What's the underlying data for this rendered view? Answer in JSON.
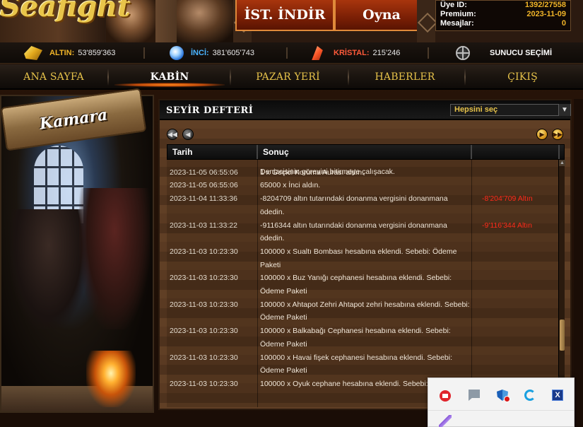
{
  "header": {
    "download_button": "İST. İNDİR",
    "play_button": "Oyna",
    "user": {
      "id_label": "Üye ID:",
      "id_value": "1392/27558",
      "premium_label": "Premium:",
      "premium_value": "2023-11-09",
      "messages_label": "Mesajlar:",
      "messages_value": "0"
    }
  },
  "resources": {
    "gold": {
      "label": "ALTIN:",
      "value": "53'859'363",
      "icon": "gold-icon",
      "color": "#f0b428"
    },
    "pearl": {
      "label": "İNCİ:",
      "value": "381'605'743",
      "icon": "pearl-icon",
      "color": "#4ab4ff"
    },
    "crystal": {
      "label": "KRİSTAL:",
      "value": "215'246",
      "icon": "crystal-icon",
      "color": "#ff5a3a"
    },
    "server": {
      "label": "SUNUCU SEÇİMİ",
      "icon": "globe-icon"
    }
  },
  "nav": {
    "items": [
      {
        "label": "ANA SAYFA"
      },
      {
        "label": "KABİN"
      },
      {
        "label": "PAZAR YERİ"
      },
      {
        "label": "HABERLER"
      },
      {
        "label": "ÇIKIŞ"
      }
    ],
    "active_index": 1
  },
  "left_panel": {
    "banner": "Kamara"
  },
  "logbook": {
    "title": "SEYİR DEFTERİ",
    "filter_value": "Hepsini seç",
    "columns": [
      "Tarih",
      "Sonuç",
      ""
    ],
    "rows": [
      {
        "date": "",
        "result": "Denizcisinin görevini bitirmeye çalışacak.",
        "amount": ""
      },
      {
        "date": "2023-11-05 06:55:06",
        "result": "1 x Geçici Koruma Aurası aldın.",
        "amount": ""
      },
      {
        "date": "2023-11-05 06:55:06",
        "result": "65000 x İnci aldın.",
        "amount": ""
      },
      {
        "date": "2023-11-04 11:33:36",
        "result": "-8204709 altın tutarındaki donanma vergisini donanmana ödedin.",
        "amount": "-8'204'709 Altın"
      },
      {
        "date": "2023-11-03 11:33:22",
        "result": "-9116344 altın tutarındaki donanma vergisini donanmana ödedin.",
        "amount": "-9'116'344 Altın"
      },
      {
        "date": "2023-11-03 10:23:30",
        "result": "100000 x Sualtı Bombası hesabına eklendi. Sebebi: Ödeme Paketi",
        "amount": ""
      },
      {
        "date": "2023-11-03 10:23:30",
        "result": "100000 x Buz Yanığı cephanesi hesabına eklendi. Sebebi: Ödeme Paketi",
        "amount": ""
      },
      {
        "date": "2023-11-03 10:23:30",
        "result": "100000 x Ahtapot Zehri Ahtapot zehri hesabına eklendi. Sebebi: Ödeme Paketi",
        "amount": ""
      },
      {
        "date": "2023-11-03 10:23:30",
        "result": "100000 x Balkabağı Cephanesi hesabına eklendi. Sebebi: Ödeme Paketi",
        "amount": ""
      },
      {
        "date": "2023-11-03 10:23:30",
        "result": "100000 x Havai fişek cephanesi hesabına eklendi. Sebebi: Ödeme Paketi",
        "amount": ""
      },
      {
        "date": "2023-11-03 10:23:30",
        "result": "100000 x Oyuk cephane hesabına eklendi. Sebebi:",
        "amount": ""
      }
    ]
  },
  "tray": {
    "icons": [
      "record-icon",
      "flag-icon",
      "shield-icon",
      "g-hub-icon",
      "app-x-icon",
      "pen-icon"
    ]
  }
}
